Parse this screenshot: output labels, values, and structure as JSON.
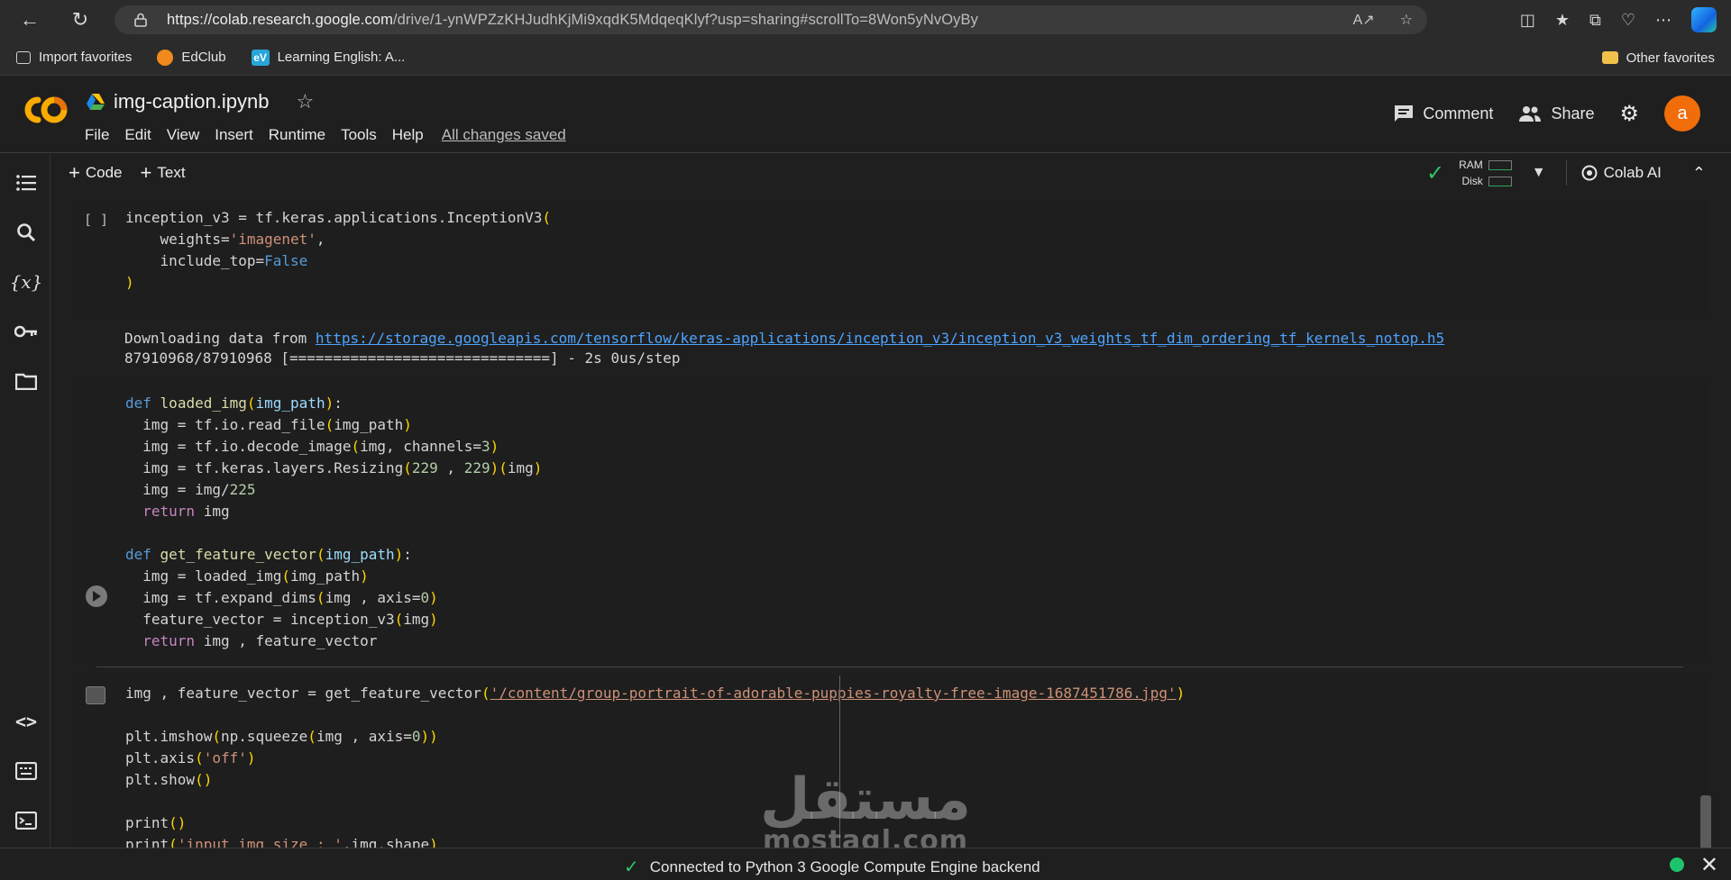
{
  "browser": {
    "url_host": "https://colab.research.google.com",
    "url_path": "/drive/1-ynWPZzKHJudhKjMi9xqdK5MdqeqKlyf?usp=sharing#scrollTo=8Won5yNvOyBy"
  },
  "favorites": {
    "items": [
      {
        "label": "Import favorites",
        "icon": "import-icon"
      },
      {
        "label": "EdClub",
        "icon": "edclub-icon"
      },
      {
        "label": "Learning English: A...",
        "icon": "ev-icon"
      }
    ],
    "other": "Other favorites"
  },
  "colab": {
    "logo": "CO",
    "notebook_title": "img-caption.ipynb",
    "menu": [
      "File",
      "Edit",
      "View",
      "Insert",
      "Runtime",
      "Tools",
      "Help"
    ],
    "saved_status": "All changes saved",
    "comment_label": "Comment",
    "share_label": "Share",
    "avatar_letter": "a"
  },
  "toolbar": {
    "code_label": "Code",
    "text_label": "Text",
    "ram_label": "RAM",
    "disk_label": "Disk",
    "colab_ai_label": "Colab AI"
  },
  "cells": {
    "cell1_gutter": "[ ]",
    "cell1_output_prefix": "Downloading data from ",
    "cell1_output_link": "https://storage.googleapis.com/tensorflow/keras-applications/inception_v3/inception_v3_weights_tf_dim_ordering_tf_kernels_notop.h5",
    "cell1_output_line2": "87910968/87910968 [==============================] - 2s 0us/step"
  },
  "watermark": {
    "arabic": "مستقل",
    "latin": "mostaql.com"
  },
  "status": {
    "message": "Connected to Python 3 Google Compute Engine backend"
  }
}
